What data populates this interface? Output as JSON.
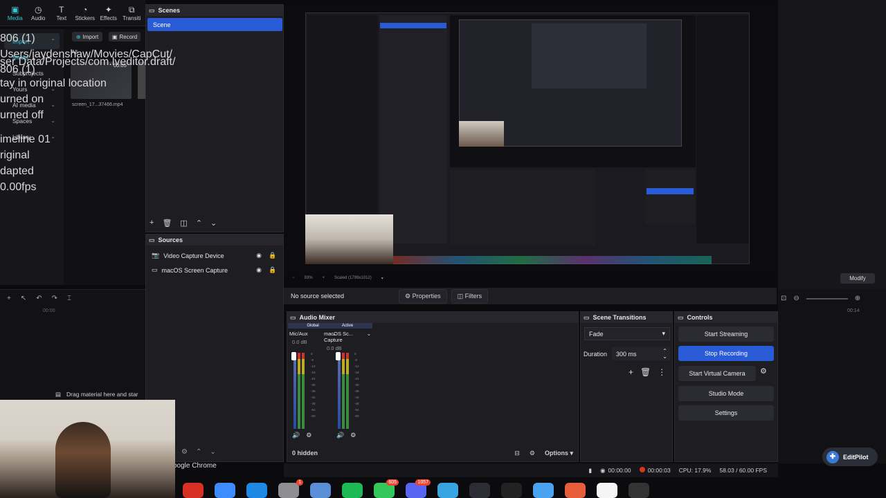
{
  "capcut": {
    "toolbar": [
      {
        "label": "Media",
        "icon": "media-icon"
      },
      {
        "label": "Audio",
        "icon": "audio-icon"
      },
      {
        "label": "Text",
        "icon": "text-icon"
      },
      {
        "label": "Stickers",
        "icon": "stickers-icon"
      },
      {
        "label": "Effects",
        "icon": "effects-icon"
      },
      {
        "label": "Transiti",
        "icon": "transitions-icon"
      }
    ],
    "sidebar": [
      {
        "label": "Import",
        "chevron": "⌃"
      },
      {
        "label": "Media",
        "chevron": ""
      },
      {
        "label": "Subprojects",
        "chevron": ""
      },
      {
        "label": "Yours",
        "chevron": "⌄"
      },
      {
        "label": "AI media",
        "chevron": "⌄"
      },
      {
        "label": "Spaces",
        "chevron": "⌄"
      },
      {
        "label": "Library",
        "chevron": "⌄"
      }
    ],
    "import_label": "Import",
    "record_label": "Record",
    "all_label": "All",
    "thumb_duration": "00:05",
    "thumb_name": "screen_17...37466.mp4",
    "drag_text": "Drag material here and star",
    "timeline_time": "00:00",
    "right_panel": {
      "lines": [
        "806 (1)",
        "Users/jaydenshaw/Movies/CapCut/",
        "ser Data/Projects/com.lveditor.draft/",
        "806 (1)",
        "tay in original location",
        "urned on",
        "urned off",
        "imeline 01",
        "riginal",
        "dapted",
        "0.00fps"
      ],
      "modify_label": "Modify",
      "time": "00:14"
    },
    "editpilot_label": "EditPilot"
  },
  "obs": {
    "scenes_title": "Scenes",
    "scene_selected": "Scene",
    "sources_title": "Sources",
    "sources": [
      {
        "name": "Video Capture Device",
        "icon": "camera-icon"
      },
      {
        "name": "macOS Screen Capture",
        "icon": "monitor-icon"
      }
    ],
    "preview_status": {
      "zoom": "93%",
      "scaled": "Scaled (1799x1012)"
    },
    "no_source": "No source selected",
    "properties_label": "Properties",
    "filters_label": "Filters",
    "mixer": {
      "title": "Audio Mixer",
      "channels": [
        {
          "tag": "Global",
          "name": "Mic/Aux",
          "db": "0.0 dB"
        },
        {
          "tag": "Active",
          "name": "macOS Sc... Capture",
          "db": "0.0 dB"
        }
      ],
      "scale": [
        "0",
        "-6",
        "-12",
        "-18",
        "-24",
        "-30",
        "-36",
        "-42",
        "-48",
        "-54",
        "-60"
      ],
      "hidden": "0 hidden",
      "options": "Options"
    },
    "transitions": {
      "title": "Scene Transitions",
      "selected": "Fade",
      "duration_label": "Duration",
      "duration_value": "300 ms"
    },
    "controls": {
      "title": "Controls",
      "start_streaming": "Start Streaming",
      "stop_recording": "Stop Recording",
      "start_virtual_camera": "Start Virtual Camera",
      "studio_mode": "Studio Mode",
      "settings": "Settings"
    },
    "status": {
      "stream_time": "00:00:00",
      "rec_time": "00:00:03",
      "cpu": "CPU: 17.9%",
      "fps": "58.03 / 60.00 FPS"
    }
  },
  "chrome_label": "oogle Chrome",
  "dock": [
    {
      "icon": "chrome-icon",
      "color": "#d93025",
      "badge": ""
    },
    {
      "icon": "mail-icon",
      "color": "#3d8bfd",
      "badge": ""
    },
    {
      "icon": "xcode-icon",
      "color": "#1e88e5",
      "badge": ""
    },
    {
      "icon": "settings-icon",
      "color": "#8e8e93",
      "badge": "1"
    },
    {
      "icon": "finder-icon",
      "color": "#5a8fd8",
      "badge": ""
    },
    {
      "icon": "spotify-icon",
      "color": "#1db954",
      "badge": ""
    },
    {
      "icon": "messages-icon",
      "color": "#34c759",
      "badge": "605"
    },
    {
      "icon": "discord-icon",
      "color": "#5865f2",
      "badge": "1057"
    },
    {
      "icon": "app-icon",
      "color": "#37a6e0",
      "badge": ""
    },
    {
      "icon": "obs-icon",
      "color": "#2c2c34",
      "badge": ""
    },
    {
      "icon": "terminal-icon",
      "color": "#222",
      "badge": ""
    },
    {
      "icon": "folder-icon",
      "color": "#4aa3f0",
      "badge": ""
    },
    {
      "icon": "capcut-icon",
      "color": "#e85d3a",
      "badge": ""
    },
    {
      "icon": "notes-icon",
      "color": "#f5f5f5",
      "badge": ""
    },
    {
      "icon": "obs2-icon",
      "color": "#333",
      "badge": ""
    }
  ]
}
